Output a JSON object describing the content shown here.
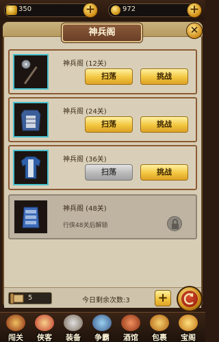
{
  "currency": {
    "gold": {
      "icon": "gold-ingot-icon",
      "value": "350"
    },
    "coin": {
      "icon": "coin-icon",
      "value": "972"
    }
  },
  "panel": {
    "title": "神兵阁",
    "close_icon": "close-icon"
  },
  "stages": [
    {
      "name": "神兵阁 (12关)",
      "item_icon": "mace-icon",
      "sweep_label": "扫荡",
      "challenge_label": "挑战",
      "sweep_enabled": true
    },
    {
      "name": "神兵阁 (24关)",
      "item_icon": "armor-icon",
      "sweep_label": "扫荡",
      "challenge_label": "挑战",
      "sweep_enabled": true
    },
    {
      "name": "神兵阁 (36关)",
      "item_icon": "robe-icon",
      "sweep_label": "扫荡",
      "challenge_label": "挑战",
      "sweep_enabled": false
    },
    {
      "name": "神兵阁 (48关)",
      "item_icon": "vest-icon",
      "locked_text": "行侠48关后解锁",
      "locked": true
    }
  ],
  "footer": {
    "scroll_count": "5",
    "remaining_text": "今日剩余次数:3",
    "add_icon": "plus-icon",
    "back_icon": "back-icon"
  },
  "nav": [
    {
      "label": "闯关",
      "icon": "warrior-icon"
    },
    {
      "label": "侠客",
      "icon": "hero-icon"
    },
    {
      "label": "装备",
      "icon": "equipment-icon"
    },
    {
      "label": "争霸",
      "icon": "battle-icon"
    },
    {
      "label": "酒馆",
      "icon": "tavern-icon"
    },
    {
      "label": "包裹",
      "icon": "bag-icon"
    },
    {
      "label": "宝阁",
      "icon": "treasure-icon"
    }
  ]
}
